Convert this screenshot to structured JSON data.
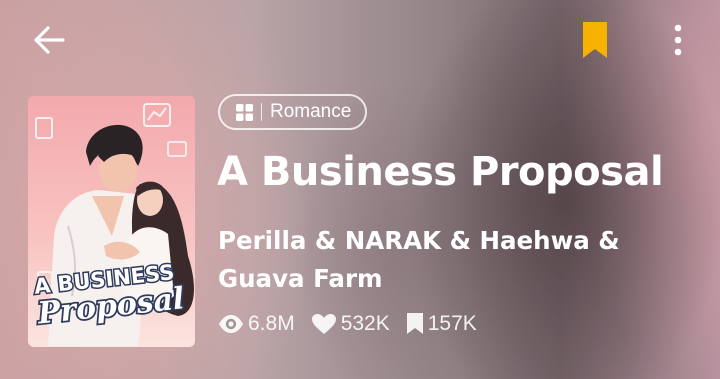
{
  "header": {
    "back_icon": "arrow-left-icon",
    "bookmark_icon": "bookmark-icon",
    "bookmark_color": "#f5b300",
    "more_icon": "more-vertical-icon"
  },
  "cover": {
    "alt": "A Business Proposal",
    "title_line1": "A BUSINESS",
    "title_line2": "Proposal"
  },
  "genre": {
    "icon": "grid-icon",
    "label": "Romance"
  },
  "series": {
    "title": "A Business Proposal",
    "authors": "Perilla & NARAK & Haehwa & Guava Farm"
  },
  "stats": {
    "views": "6.8M",
    "likes": "532K",
    "bookmarks": "157K"
  }
}
